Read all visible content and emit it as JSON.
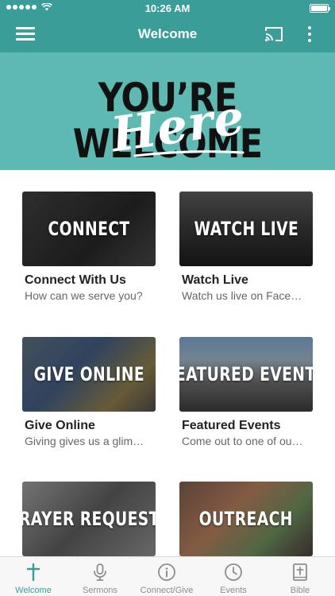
{
  "status_bar": {
    "time": "10:26 AM"
  },
  "nav": {
    "title": "Welcome"
  },
  "banner": {
    "line1": "YOU’RE WELCOME",
    "line2": "Here"
  },
  "cards": [
    {
      "image_label": "CONNECT",
      "title": "Connect With Us",
      "subtitle": "How can we serve you?"
    },
    {
      "image_label": "WATCH LIVE",
      "title": "Watch Live",
      "subtitle": "Watch us live on Face…"
    },
    {
      "image_label": "GIVE ONLINE",
      "title": "Give Online",
      "subtitle": "Giving gives us a glim…"
    },
    {
      "image_label": "FEATURED EVENTS",
      "title": "Featured Events",
      "subtitle": "Come out to one of ou…"
    },
    {
      "image_label": "PRAYER REQUESTS",
      "title": "",
      "subtitle": ""
    },
    {
      "image_label": "OUTREACH",
      "title": "",
      "subtitle": ""
    }
  ],
  "tabs": [
    {
      "label": "Welcome",
      "icon": "cross-icon",
      "active": true
    },
    {
      "label": "Sermons",
      "icon": "microphone-icon",
      "active": false
    },
    {
      "label": "Connect/Give",
      "icon": "info-icon",
      "active": false
    },
    {
      "label": "Events",
      "icon": "clock-icon",
      "active": false
    },
    {
      "label": "Bible",
      "icon": "bible-icon",
      "active": false
    }
  ],
  "colors": {
    "accent": "#3a9d98",
    "banner": "#5db9b2",
    "tab_inactive": "#8e8e8e"
  }
}
